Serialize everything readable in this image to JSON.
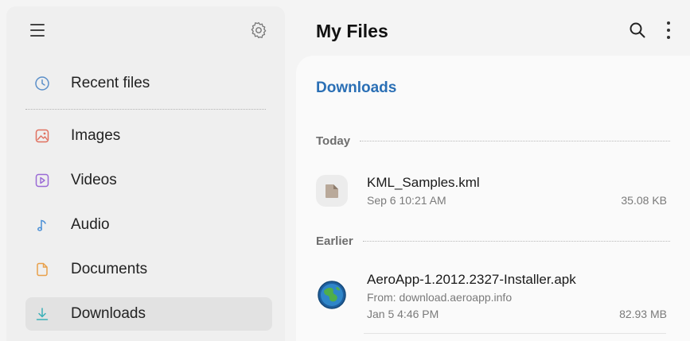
{
  "colors": {
    "accent": "#2a6fb5",
    "sidebar_bg": "#efefef",
    "active_bg": "#e2e2e2"
  },
  "sidebar": {
    "menu_icon": "hamburger-icon",
    "settings_icon": "gear-icon",
    "items": [
      {
        "label": "Recent files",
        "icon": "clock-icon"
      },
      {
        "label": "Images",
        "icon": "image-icon"
      },
      {
        "label": "Videos",
        "icon": "video-icon"
      },
      {
        "label": "Audio",
        "icon": "music-note-icon"
      },
      {
        "label": "Documents",
        "icon": "document-icon"
      },
      {
        "label": "Downloads",
        "icon": "download-icon",
        "active": true
      }
    ]
  },
  "header": {
    "title": "My Files",
    "search_icon": "search-icon",
    "more_icon": "more-vert-icon"
  },
  "main": {
    "section_title": "Downloads",
    "groups": [
      {
        "label": "Today",
        "files": [
          {
            "name": "KML_Samples.kml",
            "date": "Sep 6 10:21 AM",
            "size": "35.08 KB",
            "icon": "generic-file-icon"
          }
        ]
      },
      {
        "label": "Earlier",
        "files": [
          {
            "name": "AeroApp-1.2012.2327-Installer.apk",
            "source": "From: download.aeroapp.info",
            "date": "Jan 5 4:46 PM",
            "size": "82.93 MB",
            "icon": "apk-globe-icon"
          }
        ]
      }
    ]
  }
}
